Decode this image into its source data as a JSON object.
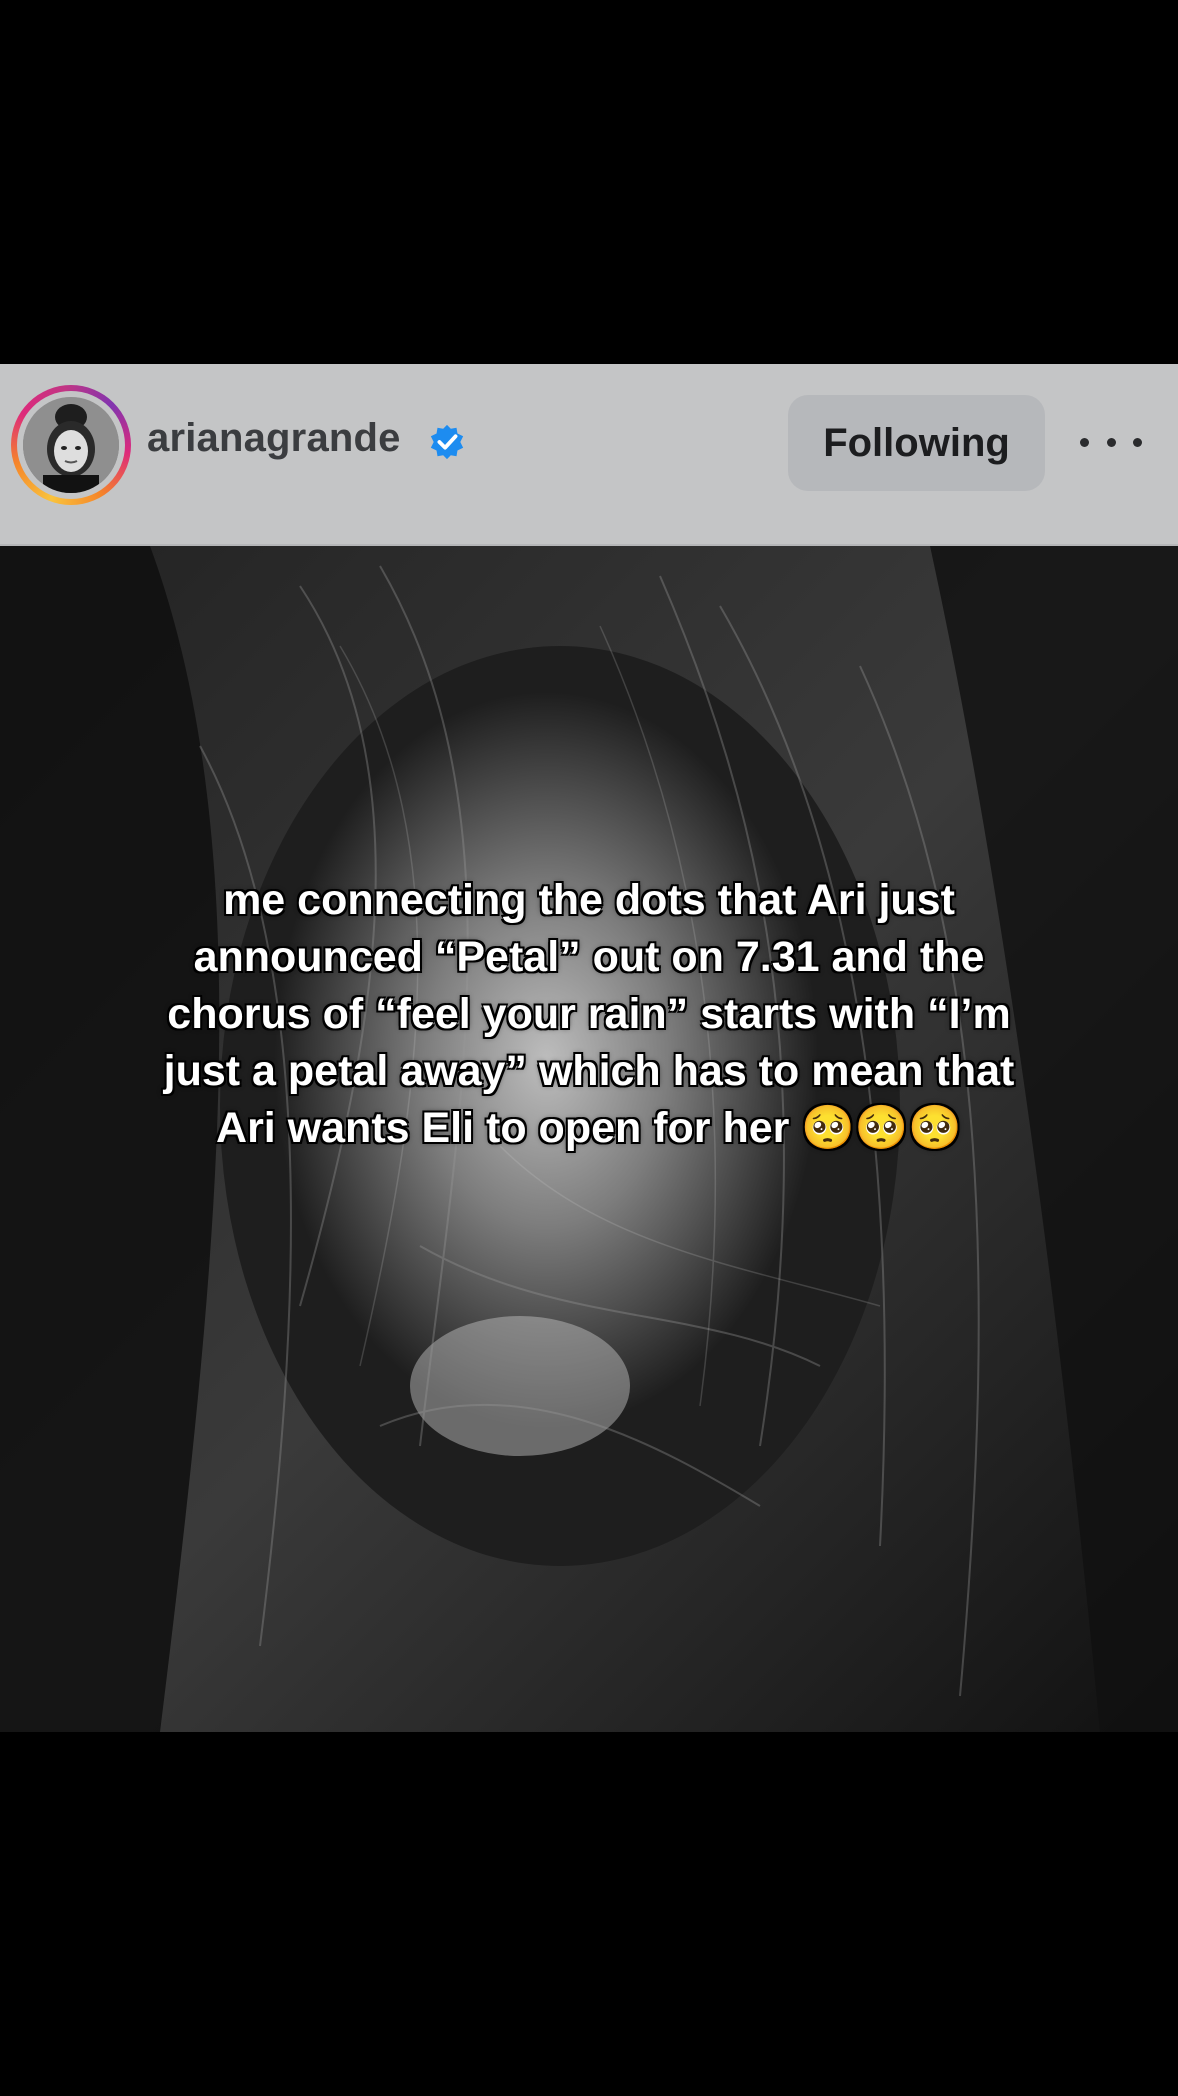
{
  "post": {
    "username": "arianagrande",
    "verified": true,
    "follow_label": "Following",
    "more_icon": "more-horizontal-icon"
  },
  "overlay": {
    "caption": "me connecting the dots that Ari just announced “Petal” out on 7.31 and the chorus of “feel your rain” starts with “I’m just a petal away” which has to mean that Ari wants Eli to open for her 🥺🥺🥺"
  },
  "colors": {
    "header_bg": "#c4c5c6",
    "follow_button_bg": "#b6b8bb",
    "verified_blue": "#1d8cf0",
    "background": "#000000"
  }
}
